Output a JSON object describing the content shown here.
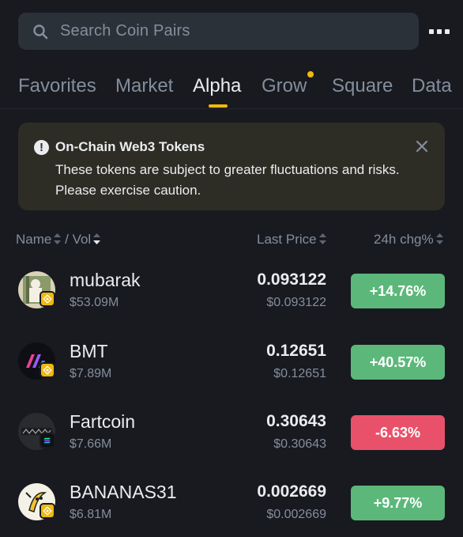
{
  "search": {
    "placeholder": "Search Coin Pairs",
    "icon": "search-icon"
  },
  "tabs": [
    {
      "label": "Favorites",
      "active": false
    },
    {
      "label": "Market",
      "active": false
    },
    {
      "label": "Alpha",
      "active": true
    },
    {
      "label": "Grow",
      "active": false,
      "has_dot": true
    },
    {
      "label": "Square",
      "active": false
    },
    {
      "label": "Data",
      "active": false
    }
  ],
  "notice": {
    "title": "On-Chain Web3 Tokens",
    "body": "These tokens are subject to greater fluctuations and risks. Please exercise caution."
  },
  "columns": {
    "name": "Name",
    "separator": "/",
    "vol": "Vol",
    "last_price": "Last Price",
    "change": "24h chg%"
  },
  "rows": [
    {
      "name": "mubarak",
      "vol": "$53.09M",
      "price": "0.093122",
      "price_usd": "$0.093122",
      "change": "+14.76%",
      "direction": "up"
    },
    {
      "name": "BMT",
      "vol": "$7.89M",
      "price": "0.12651",
      "price_usd": "$0.12651",
      "change": "+40.57%",
      "direction": "up"
    },
    {
      "name": "Fartcoin",
      "vol": "$7.66M",
      "price": "0.30643",
      "price_usd": "$0.30643",
      "change": "-6.63%",
      "direction": "down"
    },
    {
      "name": "BANANAS31",
      "vol": "$6.81M",
      "price": "0.002669",
      "price_usd": "$0.002669",
      "change": "+9.77%",
      "direction": "up"
    }
  ],
  "colors": {
    "background": "#181a20",
    "accent": "#f0b90b",
    "up": "#5cb87a",
    "down": "#e9516a",
    "muted_text": "#848e9c",
    "notice_bg": "#2e2d25"
  }
}
